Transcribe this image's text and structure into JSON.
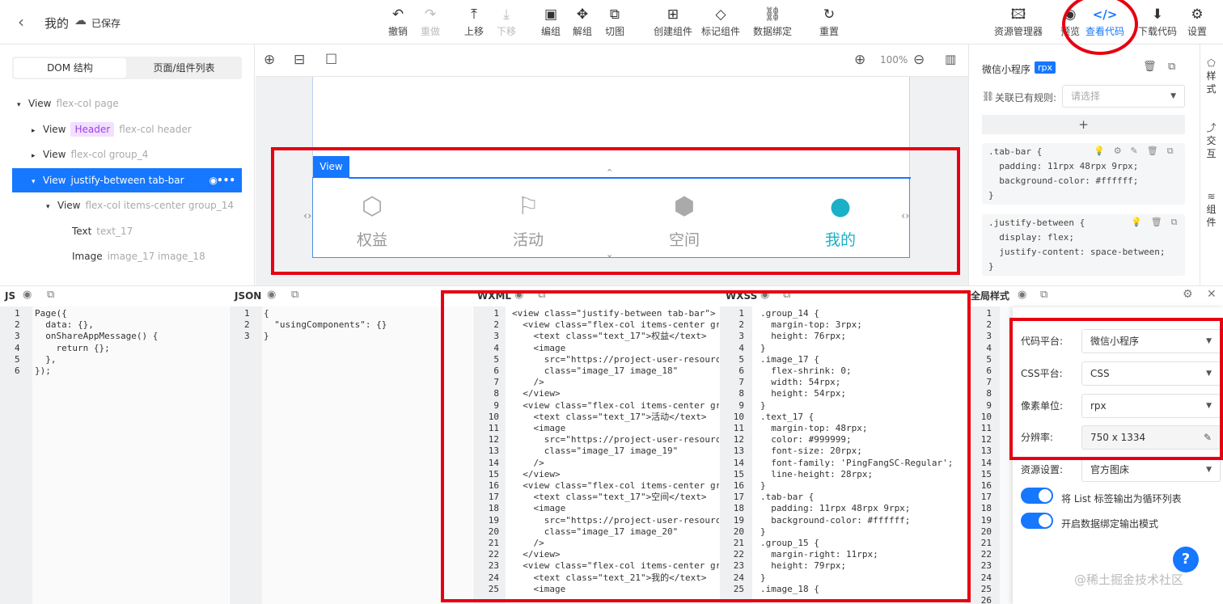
{
  "topbar": {
    "back": "‹",
    "title": "我的",
    "saved": "已保存",
    "tools": [
      {
        "icon": "↶",
        "label": "撤销"
      },
      {
        "icon": "↷",
        "label": "重做"
      },
      {
        "icon": "⤒",
        "label": "上移"
      },
      {
        "icon": "⤓",
        "label": "下移"
      },
      {
        "icon": "▣",
        "label": "编组"
      },
      {
        "icon": "✥",
        "label": "解组"
      },
      {
        "icon": "⧉",
        "label": "切图"
      },
      {
        "icon": "⊞",
        "label": "创建组件"
      },
      {
        "icon": "◇",
        "label": "标记组件"
      },
      {
        "icon": "⛓",
        "label": "数据绑定"
      },
      {
        "icon": "↻",
        "label": "重置"
      }
    ],
    "right_tools": [
      {
        "icon": "🖾",
        "label": "资源管理器"
      },
      {
        "icon": "◉",
        "label": "预览"
      },
      {
        "icon": "</>",
        "label": "查看代码"
      },
      {
        "icon": "⬇",
        "label": "下载代码"
      },
      {
        "icon": "⚙",
        "label": "设置"
      }
    ]
  },
  "left": {
    "tabs": [
      "DOM 结构",
      "页面/组件列表"
    ],
    "tree": [
      {
        "arrow": "▾",
        "type": "View",
        "cls": "flex-col page",
        "indent": 0
      },
      {
        "arrow": "▸",
        "type": "View",
        "tag": "Header",
        "cls": "flex-col header",
        "indent": 1
      },
      {
        "arrow": "▸",
        "type": "View",
        "cls": "flex-col group_4",
        "indent": 1
      },
      {
        "arrow": "▾",
        "type": "View",
        "cls": "justify-between tab-bar",
        "indent": 1
      },
      {
        "arrow": "▾",
        "type": "View",
        "cls": "flex-col items-center group_14",
        "indent": 2
      },
      {
        "arrow": "",
        "type": "Text",
        "cls": "text_17",
        "indent": 3
      },
      {
        "arrow": "",
        "type": "Image",
        "cls": "image_17 image_18",
        "indent": 3
      }
    ]
  },
  "canvas": {
    "zoom": "100%",
    "view_label": "View",
    "tabs": [
      {
        "icon": "⬡",
        "label": "权益",
        "active": false
      },
      {
        "icon": "⚐",
        "label": "活动",
        "active": false
      },
      {
        "icon": "⬢",
        "label": "空间",
        "active": false
      },
      {
        "icon": "●",
        "label": "我的",
        "active": true
      }
    ]
  },
  "right": {
    "platform": "微信小程序",
    "unit_badge": "rpx",
    "link_label": "关联已有规则:",
    "link_placeholder": "请选择",
    "add": "+",
    "rule1": ".tab-bar {\n  padding: 11rpx 48rpx 9rpx;\n  background-color: #ffffff;\n}",
    "rule2": ".justify-between {\n  display: flex;\n  justify-content: space-between;\n}",
    "vtabs": [
      "样式",
      "交互",
      "组件"
    ]
  },
  "panels": {
    "js": "JS",
    "json": "JSON",
    "wxml": "WXML",
    "wxss": "WXSS",
    "global": "全局样式"
  },
  "code": {
    "js_lines": "1\n2\n3\n4\n5\n6",
    "js": "Page({\n  data: {},\n  onShareAppMessage() {\n    return {};\n  },\n});",
    "json_lines": "1\n2\n3",
    "json": "{\n  \"usingComponents\": {}\n}",
    "wxml_lines": "1\n2\n3\n4\n5\n6\n7\n8\n9\n10\n11\n12\n13\n14\n15\n16\n17\n18\n19\n20\n21\n22\n23\n24\n25",
    "wxml": "<view class=\"justify-between tab-bar\">\n  <view class=\"flex-col items-center gro\n    <text class=\"text_17\">权益</text>\n    <image\n      src=\"https://project-user-resource\n      class=\"image_17 image_18\"\n    />\n  </view>\n  <view class=\"flex-col items-center gro\n    <text class=\"text_17\">活动</text>\n    <image\n      src=\"https://project-user-resource\n      class=\"image_17 image_19\"\n    />\n  </view>\n  <view class=\"flex-col items-center gro\n    <text class=\"text_17\">空间</text>\n    <image\n      src=\"https://project-user-resource\n      class=\"image_17 image_20\"\n    />\n  </view>\n  <view class=\"flex-col items-center gro\n    <text class=\"text_21\">我的</text>\n    <image",
    "wxss_lines": "1\n2\n3\n4\n5\n6\n7\n8\n9\n10\n11\n12\n13\n14\n15\n16\n17\n18\n19\n20\n21\n22\n23\n24\n25",
    "wxss": ".group_14 {\n  margin-top: 3rpx;\n  height: 76rpx;\n}\n.image_17 {\n  flex-shrink: 0;\n  width: 54rpx;\n  height: 54rpx;\n}\n.text_17 {\n  margin-top: 48rpx;\n  color: #999999;\n  font-size: 20rpx;\n  font-family: 'PingFangSC-Regular';\n  line-height: 28rpx;\n}\n.tab-bar {\n  padding: 11rpx 48rpx 9rpx;\n  background-color: #ffffff;\n}\n.group_15 {\n  margin-right: 11rpx;\n  height: 79rpx;\n}\n.image_18 {",
    "global_lines": "1\n2\n3\n4\n5\n6\n7\n8\n9\n10\n11\n12\n13\n14\n15\n16\n17\n18\n19\n20\n21\n22\n23\n24\n25\n26"
  },
  "settings": {
    "rows": [
      {
        "label": "代码平台:",
        "value": "微信小程序"
      },
      {
        "label": "CSS平台:",
        "value": "CSS"
      },
      {
        "label": "像素单位:",
        "value": "rpx"
      },
      {
        "label": "分辨率:",
        "value": "750 x 1334"
      },
      {
        "label": "资源设置:",
        "value": "官方图床"
      }
    ],
    "toggle1": "将 List 标签输出为循环列表",
    "toggle2": "开启数据绑定输出模式"
  },
  "watermark": "@稀土掘金技术社区",
  "colors": {
    "accent": "#1677ff",
    "highlight": "#e60012",
    "active_tab": "#1ab0c8"
  }
}
